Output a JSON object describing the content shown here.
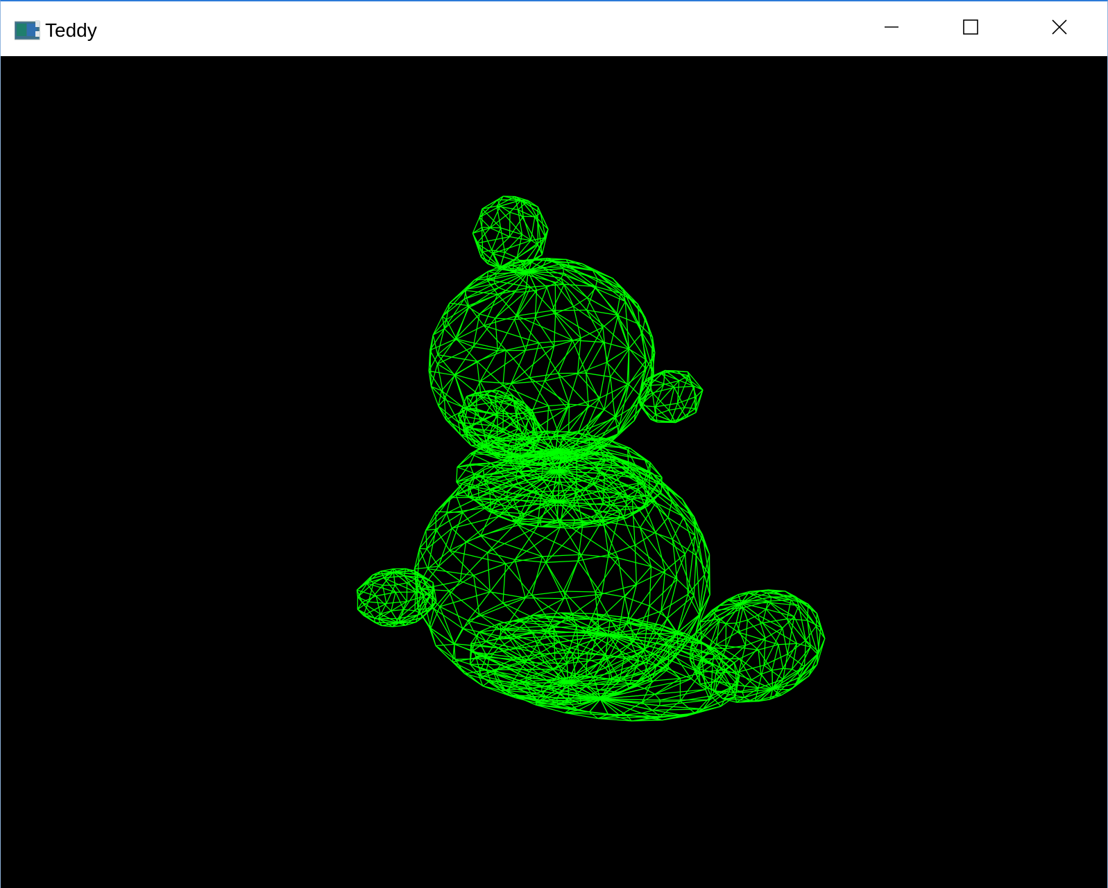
{
  "window": {
    "title": "Teddy",
    "app_icon": "opengl-app-icon",
    "controls": {
      "minimize": "minimize-icon",
      "maximize": "maximize-icon",
      "close": "close-icon"
    }
  },
  "viewport": {
    "background": "#000000",
    "wireframe_color": "#00ff00",
    "model": "teddy-bear-wireframe"
  }
}
